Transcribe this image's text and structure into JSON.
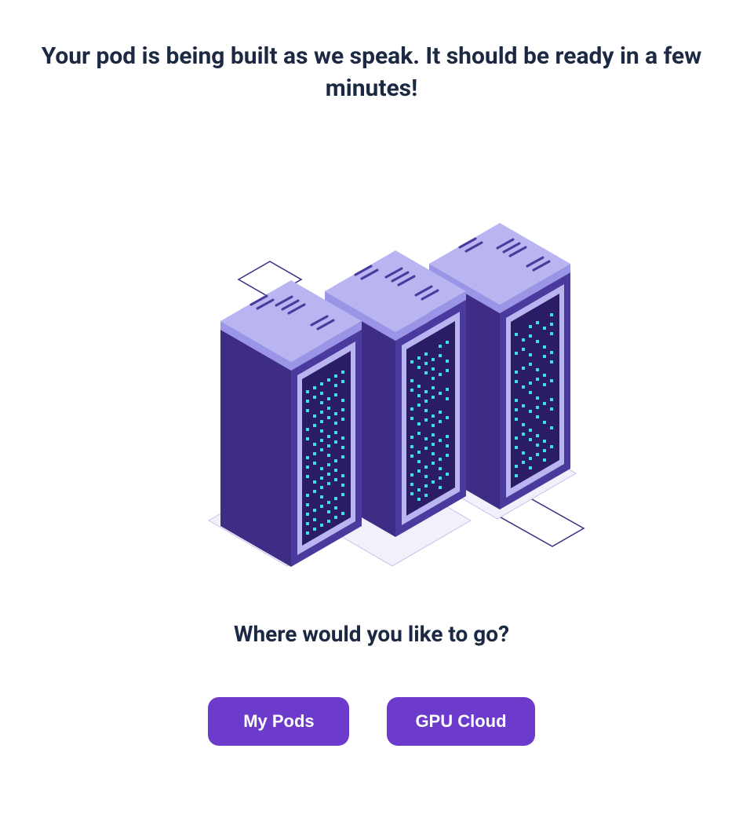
{
  "heading": "Your pod is being built as we speak. It should be ready in a few minutes!",
  "nav_question": "Where would you like to go?",
  "buttons": {
    "my_pods": "My Pods",
    "gpu_cloud": "GPU Cloud"
  },
  "colors": {
    "accent": "#6c3bcc",
    "text_dark": "#1c2942",
    "server_dark": "#3e2c85",
    "server_light": "#b8b5f0",
    "server_face": "#4a3a9e",
    "led": "#3de0e0"
  },
  "illustration": {
    "name": "servers-icon",
    "description": "isometric server rack illustration"
  }
}
